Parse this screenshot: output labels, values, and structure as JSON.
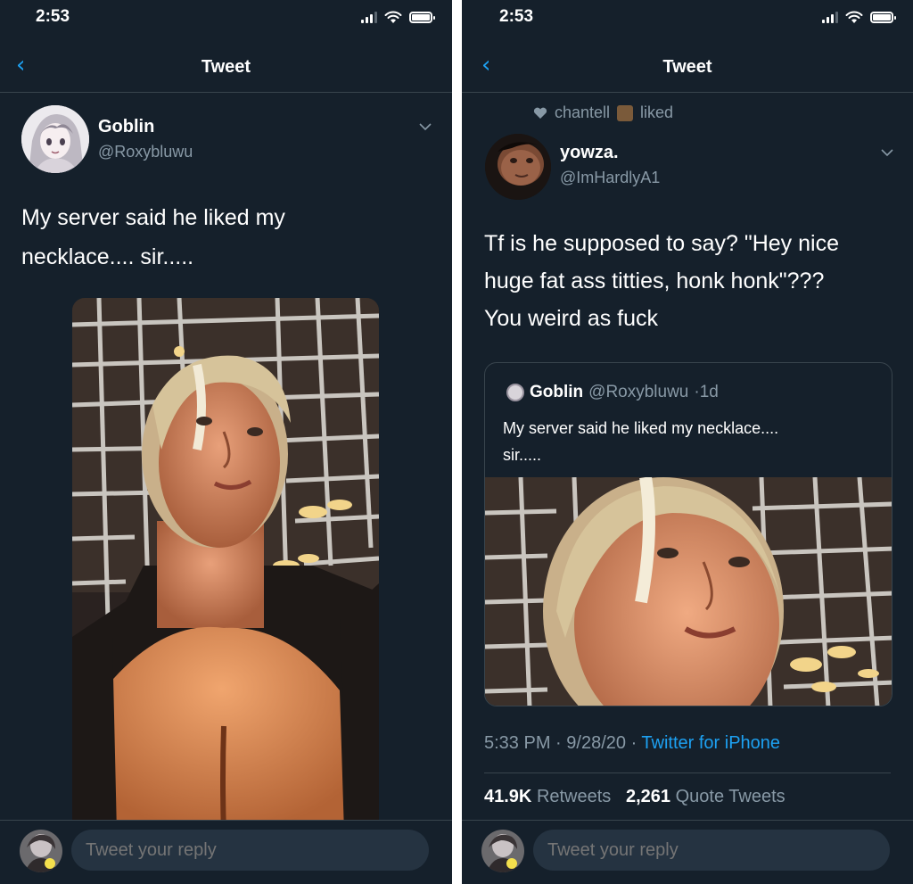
{
  "left_screen": {
    "status_time": "2:53",
    "nav_title": "Tweet",
    "tweet": {
      "author_name": "Goblin",
      "author_handle": "@Roxybluwu",
      "text_line1": "My server said he liked my",
      "text_line2": "necklace.... sir....."
    },
    "reply_placeholder": "Tweet your reply"
  },
  "right_screen": {
    "status_time": "2:53",
    "nav_title": "Tweet",
    "social_context": {
      "user": "chantell",
      "action": "liked"
    },
    "tweet": {
      "author_name": "yowza.",
      "author_handle": "@ImHardlyA1",
      "text_line1": "Tf is he supposed to say? \"Hey nice",
      "text_line2": "huge fat ass titties, honk honk\"???",
      "text_line3": "You weird as fuck"
    },
    "quoted_tweet": {
      "author_name": "Goblin",
      "author_handle": "@Roxybluwu",
      "age": "1d",
      "text_line1": "My server said he liked my necklace....",
      "text_line2": "sir....."
    },
    "meta": {
      "time": "5:33 PM",
      "date": "9/28/20",
      "source": "Twitter for iPhone"
    },
    "stats": {
      "retweets_count": "41.9K",
      "retweets_label": "Retweets",
      "quotes_count": "2,261",
      "quotes_label": "Quote Tweets"
    },
    "reply_placeholder": "Tweet your reply"
  },
  "colors": {
    "background": "#15202b",
    "accent": "#1da1f2",
    "secondary_text": "#8899a6",
    "divider": "#38444d"
  },
  "icons": [
    "back-chevron-icon",
    "signal-icon",
    "wifi-icon",
    "battery-icon",
    "chevron-down-icon",
    "heart-icon"
  ]
}
